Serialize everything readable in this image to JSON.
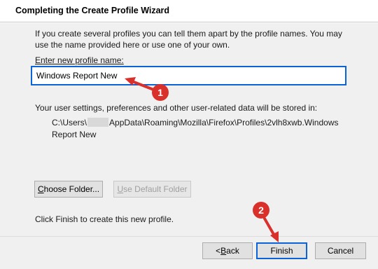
{
  "wizard": {
    "title": "Completing the Create Profile Wizard",
    "intro": "If you create several profiles you can tell them apart by the profile names. You may use the name provided here or use one of your own.",
    "input_label": "Enter new profile name:",
    "profile_name": "Windows Report New",
    "stored_note": "Your user settings, preferences and other user-related data will be stored in:",
    "path_prefix": "C:\\Users\\",
    "path_rest": "AppData\\Roaming\\Mozilla\\Firefox\\Profiles\\2vlh8xwb.Windows Report New",
    "choose_folder_underline": "C",
    "choose_folder_rest": "hoose Folder...",
    "use_default_underline": "U",
    "use_default_rest": "se Default Folder",
    "finish_note": "Click Finish to create this new profile."
  },
  "buttons": {
    "back_prefix": "< ",
    "back_underline": "B",
    "back_rest": "ack",
    "finish": "Finish",
    "cancel": "Cancel"
  },
  "annotations": {
    "badge1": "1",
    "badge2": "2",
    "accent_color": "#d9302c"
  }
}
